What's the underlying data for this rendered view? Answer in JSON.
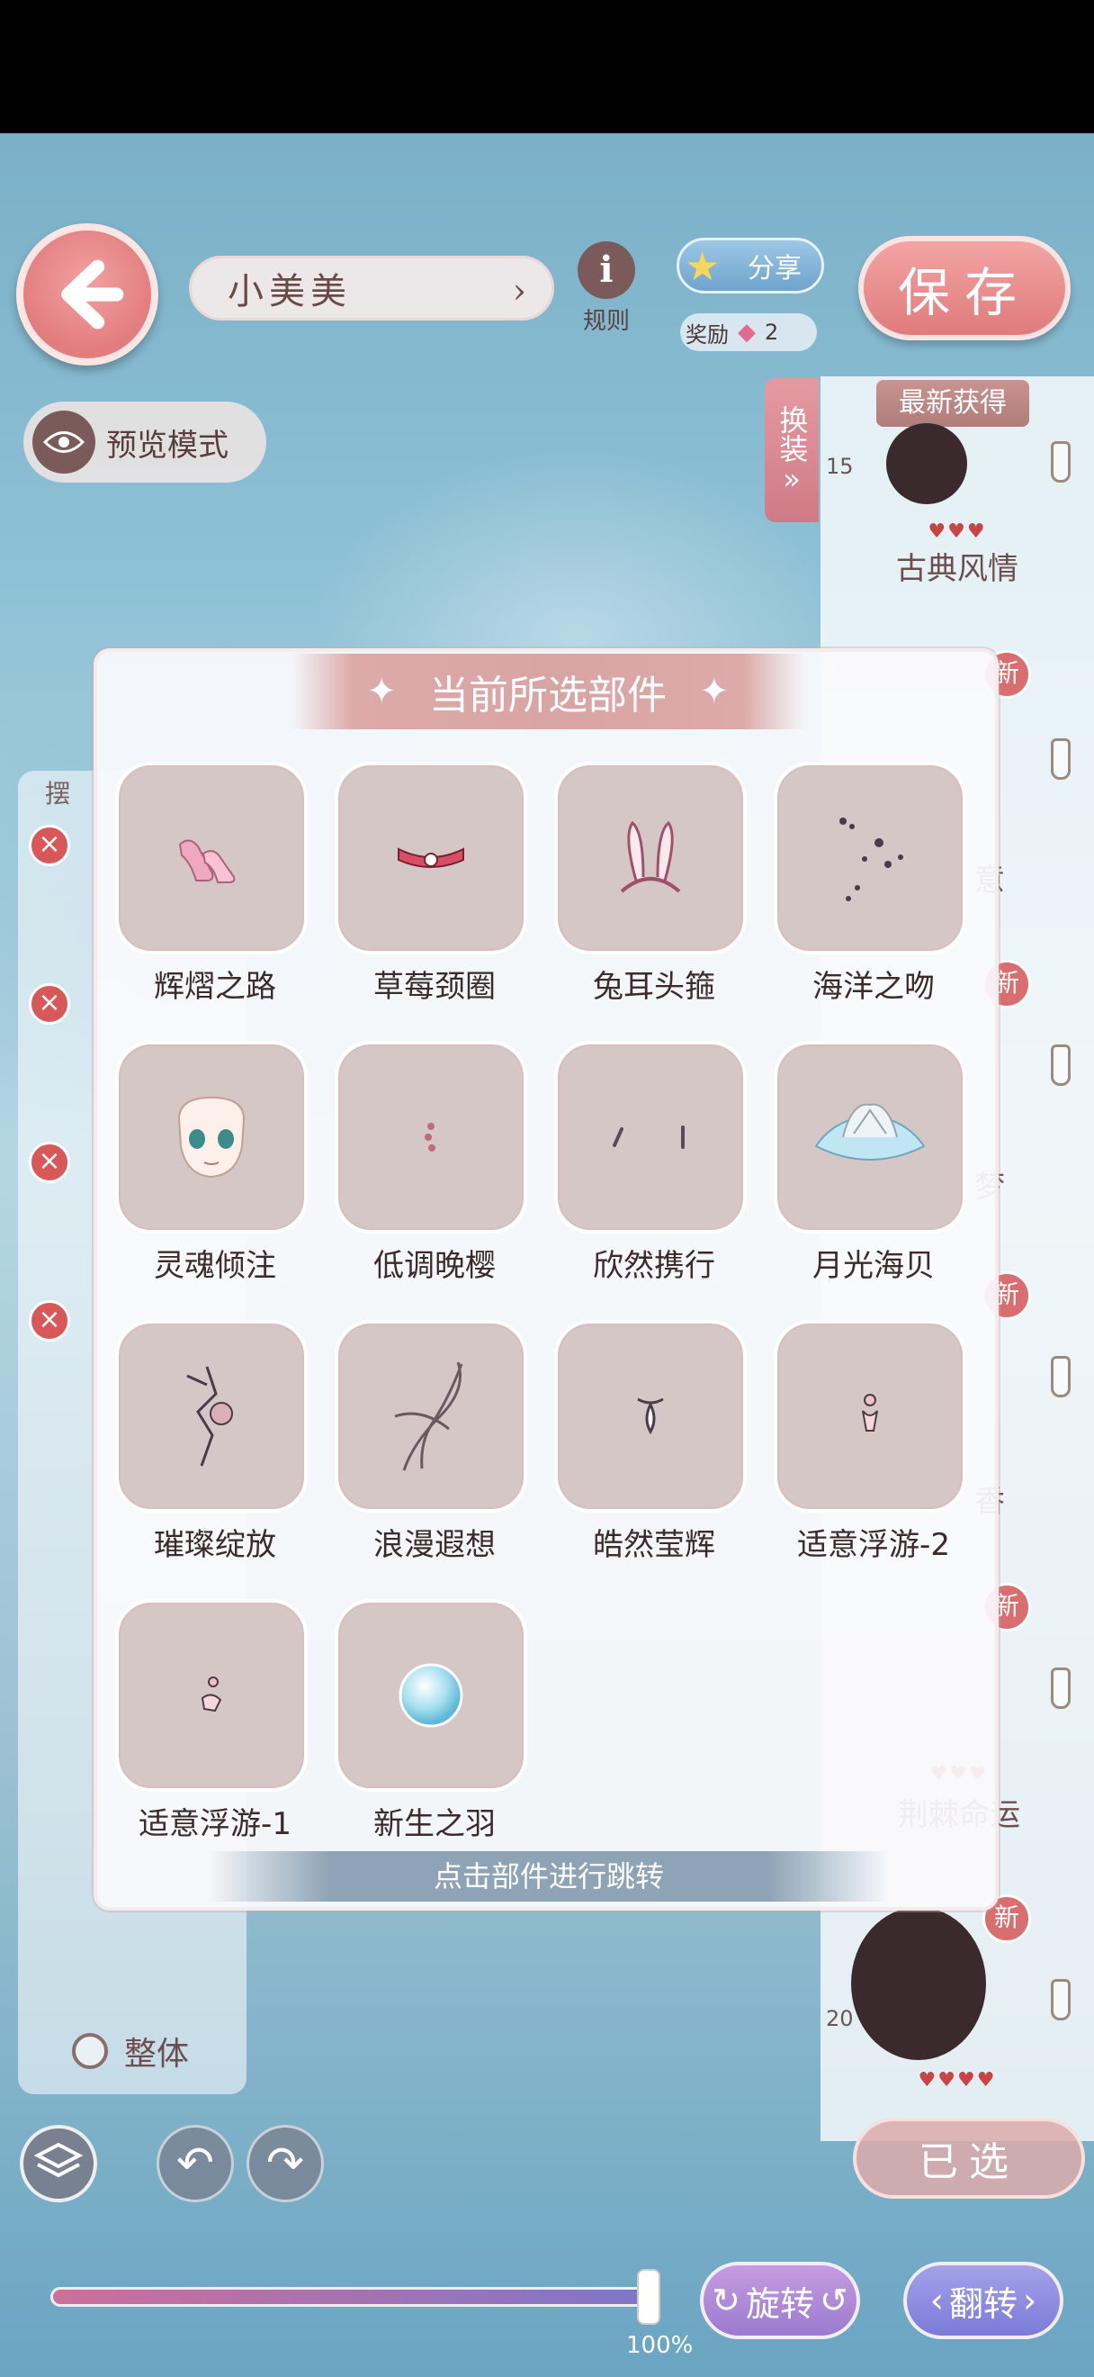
{
  "header": {
    "profile_name": "小美美",
    "rules_label": "规则",
    "share_label": "分享",
    "reward_label": "奖励",
    "reward_count": "2",
    "save_label": "保存",
    "preview_label": "预览模式"
  },
  "right_panel": {
    "change_tab": "换装",
    "latest_tag": "最新获得",
    "items": [
      {
        "number": "15",
        "name": "古典风情",
        "hearts": "♥♥♥"
      },
      {
        "new": "新",
        "name": "意"
      },
      {
        "new": "新",
        "name": "梦"
      },
      {
        "new": "新",
        "name": "香"
      },
      {
        "new": "新",
        "name": "荆棘命运",
        "hearts": "♥♥♥"
      },
      {
        "new": "新",
        "number": "20",
        "hearts": "♥♥♥♥"
      }
    ],
    "selected_label": "已选"
  },
  "left_panel": {
    "tab_label": "摆",
    "whole_label": "整体"
  },
  "bottom": {
    "zoom": "100%",
    "zoom_fraction": 1.0,
    "rotate_label": "旋转",
    "flip_label": "翻转"
  },
  "modal": {
    "title": "当前所选部件",
    "footer": "点击部件进行跳转",
    "parts": [
      {
        "name": "辉熠之路",
        "icon": "shoes-icon"
      },
      {
        "name": "草莓颈圈",
        "icon": "choker-icon"
      },
      {
        "name": "兔耳头箍",
        "icon": "bunny-ears-icon"
      },
      {
        "name": "海洋之吻",
        "icon": "sparkle-decal-icon"
      },
      {
        "name": "灵魂倾注",
        "icon": "face-icon"
      },
      {
        "name": "低调晚樱",
        "icon": "earring-icon"
      },
      {
        "name": "欣然携行",
        "icon": "earrings-pair-icon"
      },
      {
        "name": "月光海贝",
        "icon": "seashell-icon"
      },
      {
        "name": "璀璨绽放",
        "icon": "flower-ribbon-icon"
      },
      {
        "name": "浪漫遐想",
        "icon": "ribbon-icon"
      },
      {
        "name": "皓然莹辉",
        "icon": "necklace-icon"
      },
      {
        "name": "适意浮游-2",
        "icon": "charm-icon"
      },
      {
        "name": "适意浮游-1",
        "icon": "charm-small-icon"
      },
      {
        "name": "新生之羽",
        "icon": "bubble-icon"
      }
    ]
  }
}
